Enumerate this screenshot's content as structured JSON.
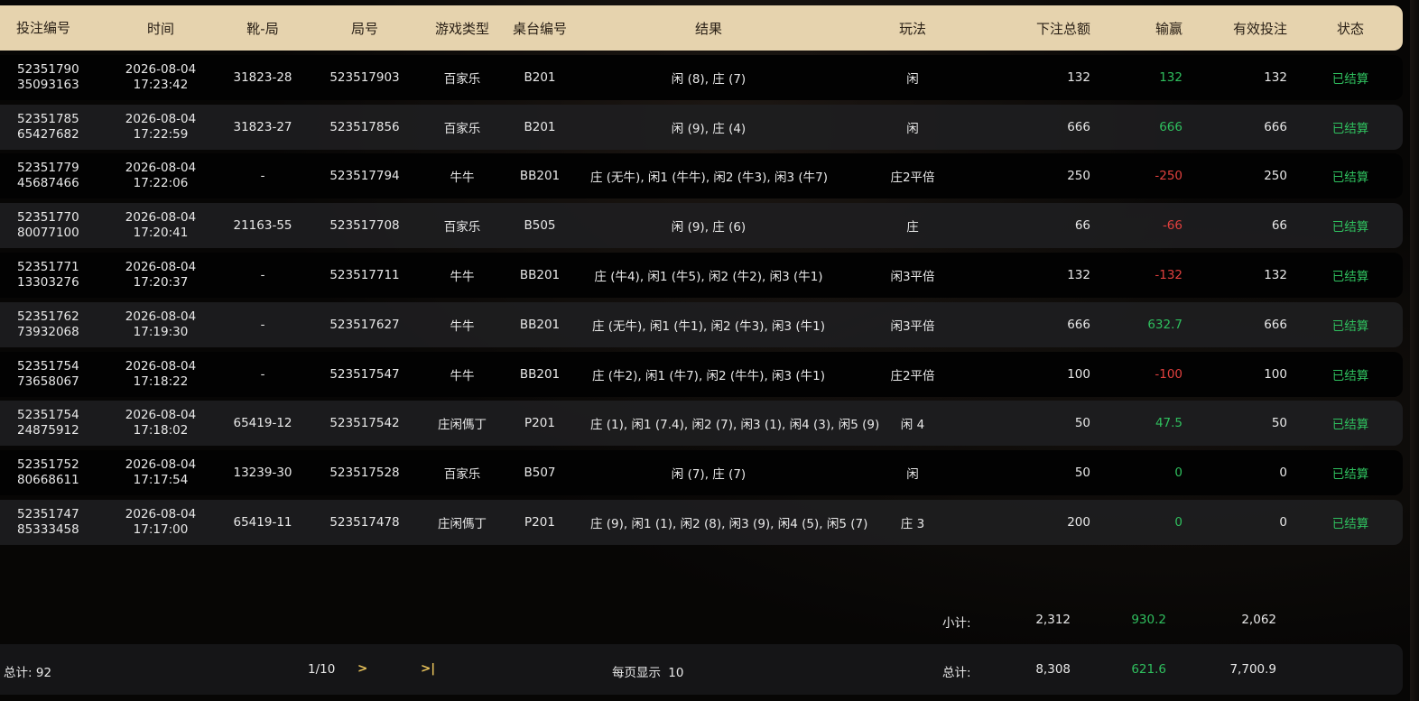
{
  "columns": [
    "投注编号",
    "时间",
    "靴-局",
    "局号",
    "游戏类型",
    "桌台编号",
    "结果",
    "玩法",
    "下注总额",
    "输赢",
    "有效投注",
    "状态"
  ],
  "rows": [
    {
      "id1": "52351790",
      "id2": "35093163",
      "date": "2026-08-04",
      "time": "17:23:42",
      "shoe": "31823-28",
      "round": "523517903",
      "game": "百家乐",
      "table": "B201",
      "result": "闲 (8), 庄 (7)",
      "play": "闲",
      "bet": "132",
      "winloss": "132",
      "wl": "win",
      "valid": "132",
      "status": "已结算"
    },
    {
      "id1": "52351785",
      "id2": "65427682",
      "date": "2026-08-04",
      "time": "17:22:59",
      "shoe": "31823-27",
      "round": "523517856",
      "game": "百家乐",
      "table": "B201",
      "result": "闲 (9), 庄 (4)",
      "play": "闲",
      "bet": "666",
      "winloss": "666",
      "wl": "win",
      "valid": "666",
      "status": "已结算"
    },
    {
      "id1": "52351779",
      "id2": "45687466",
      "date": "2026-08-04",
      "time": "17:22:06",
      "shoe": "-",
      "round": "523517794",
      "game": "牛牛",
      "table": "BB201",
      "result": "庄 (无牛), 闲1 (牛牛), 闲2 (牛3), 闲3 (牛7)",
      "play": "庄2平倍",
      "bet": "250",
      "winloss": "-250",
      "wl": "lose",
      "valid": "250",
      "status": "已结算"
    },
    {
      "id1": "52351770",
      "id2": "80077100",
      "date": "2026-08-04",
      "time": "17:20:41",
      "shoe": "21163-55",
      "round": "523517708",
      "game": "百家乐",
      "table": "B505",
      "result": "闲 (9), 庄 (6)",
      "play": "庄",
      "bet": "66",
      "winloss": "-66",
      "wl": "lose",
      "valid": "66",
      "status": "已结算"
    },
    {
      "id1": "52351771",
      "id2": "13303276",
      "date": "2026-08-04",
      "time": "17:20:37",
      "shoe": "-",
      "round": "523517711",
      "game": "牛牛",
      "table": "BB201",
      "result": "庄 (牛4), 闲1 (牛5), 闲2 (牛2), 闲3 (牛1)",
      "play": "闲3平倍",
      "bet": "132",
      "winloss": "-132",
      "wl": "lose",
      "valid": "132",
      "status": "已结算"
    },
    {
      "id1": "52351762",
      "id2": "73932068",
      "date": "2026-08-04",
      "time": "17:19:30",
      "shoe": "-",
      "round": "523517627",
      "game": "牛牛",
      "table": "BB201",
      "result": "庄 (无牛), 闲1 (牛1), 闲2 (牛3), 闲3 (牛1)",
      "play": "闲3平倍",
      "bet": "666",
      "winloss": "632.7",
      "wl": "win",
      "valid": "666",
      "status": "已结算"
    },
    {
      "id1": "52351754",
      "id2": "73658067",
      "date": "2026-08-04",
      "time": "17:18:22",
      "shoe": "-",
      "round": "523517547",
      "game": "牛牛",
      "table": "BB201",
      "result": "庄 (牛2), 闲1 (牛7), 闲2 (牛牛), 闲3 (牛1)",
      "play": "庄2平倍",
      "bet": "100",
      "winloss": "-100",
      "wl": "lose",
      "valid": "100",
      "status": "已结算"
    },
    {
      "id1": "52351754",
      "id2": "24875912",
      "date": "2026-08-04",
      "time": "17:18:02",
      "shoe": "65419-12",
      "round": "523517542",
      "game": "庄闲傌丁",
      "table": "P201",
      "result": "庄 (1), 闲1 (7.4), 闲2 (7), 闲3 (1), 闲4 (3), 闲5 (9)",
      "play": "闲 4",
      "bet": "50",
      "winloss": "47.5",
      "wl": "win",
      "valid": "50",
      "status": "已结算"
    },
    {
      "id1": "52351752",
      "id2": "80668611",
      "date": "2026-08-04",
      "time": "17:17:54",
      "shoe": "13239-30",
      "round": "523517528",
      "game": "百家乐",
      "table": "B507",
      "result": "闲 (7), 庄 (7)",
      "play": "闲",
      "bet": "50",
      "winloss": "0",
      "wl": "win",
      "valid": "0",
      "status": "已结算"
    },
    {
      "id1": "52351747",
      "id2": "85333458",
      "date": "2026-08-04",
      "time": "17:17:00",
      "shoe": "65419-11",
      "round": "523517478",
      "game": "庄闲傌丁",
      "table": "P201",
      "result": "庄 (9), 闲1 (1), 闲2 (8), 闲3 (9), 闲4 (5), 闲5 (7)",
      "play": "庄 3",
      "bet": "200",
      "winloss": "0",
      "wl": "win",
      "valid": "0",
      "status": "已结算"
    }
  ],
  "subtotal": {
    "label": "小计:",
    "bet": "2,312",
    "winloss": "930.2",
    "valid": "2,062"
  },
  "footer": {
    "count_label": "总计:",
    "count": "92",
    "page": "1/10",
    "next": ">",
    "last": ">|",
    "per_page_label": "每页显示",
    "per_page": "10",
    "total_label": "总计:",
    "bet": "8,308",
    "winloss": "621.6",
    "valid": "7,700.9"
  },
  "colors": {
    "header_bg": "#e6d3ae",
    "win": "#2fbf5e",
    "lose": "#e0403e",
    "pager": "#e8c25a"
  }
}
